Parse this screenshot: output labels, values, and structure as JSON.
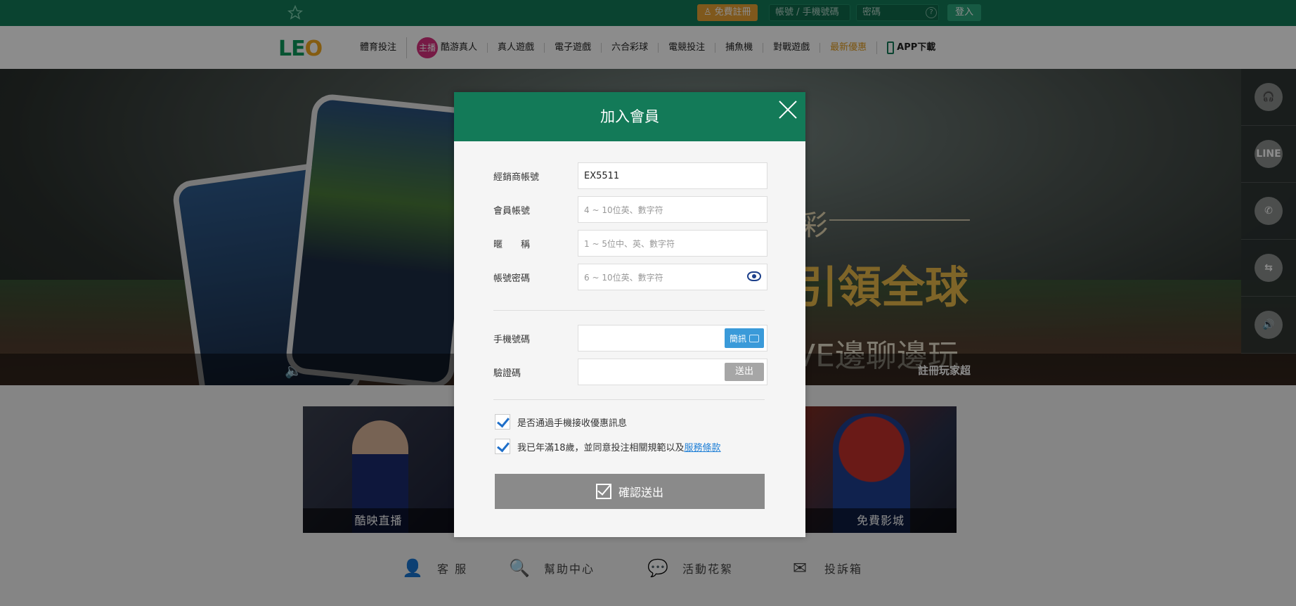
{
  "topbar": {
    "free_register": "免費註冊",
    "account_placeholder": "帳號 / 手機號碼",
    "password_placeholder": "密碼",
    "help_glyph": "?",
    "login": "登入"
  },
  "logo": {
    "part1": "LE",
    "part2": "O"
  },
  "nav": {
    "items": [
      "體育投注",
      "酷游真人",
      "真人遊戲",
      "電子遊戲",
      "六合彩球",
      "電競投注",
      "捕魚機",
      "對戰遊戲",
      "最新優惠",
      "APP下載"
    ],
    "live_badge": "主播"
  },
  "banner": {
    "slogan_1": "彩",
    "slogan_2": "引領全球",
    "slogan_3": "VE邊聊邊玩",
    "ticker": "註冊玩家超"
  },
  "sidebar": {
    "line_label": "LINE"
  },
  "tiles": {
    "left_caption": "酷映直播",
    "right_caption": "免費影城"
  },
  "footer": {
    "service": "客 服",
    "help": "幫助中心",
    "events": "活動花絮",
    "complaint": "投訴箱"
  },
  "modal": {
    "title": "加入會員",
    "agent_label": "經銷商帳號",
    "agent_value": "EX5511",
    "account_label": "會員帳號",
    "account_placeholder": "4 ~ 10位英、數字符",
    "nickname_label": "暱　　稱",
    "nickname_placeholder": "1 ~ 5位中、英、數字符",
    "password_label": "帳號密碼",
    "password_placeholder": "6 ~ 10位英、數字符",
    "phone_label": "手機號碼",
    "sms_button": "簡訊",
    "code_label": "驗證碼",
    "send_button": "送出",
    "opt_in_label": "是否通過手機接收優惠訊息",
    "age_label": "我已年滿18歲，並同意投注相關規範以及",
    "terms_link": "服務條款",
    "submit": "確認送出"
  },
  "colors": {
    "brand": "#137a58",
    "accent": "#e8a033",
    "link": "#1f7fd6"
  }
}
